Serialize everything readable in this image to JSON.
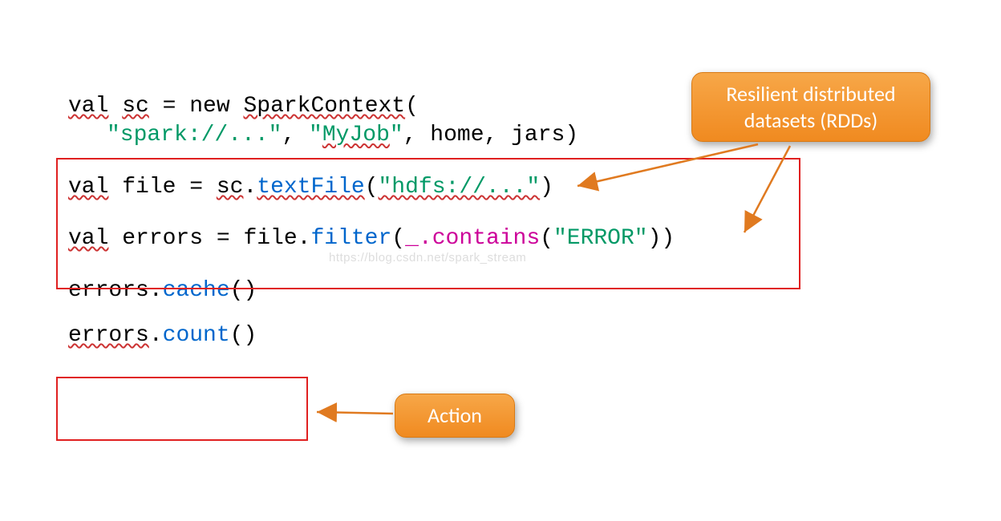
{
  "code": {
    "line1": {
      "val": "val",
      "sc": "sc",
      "eqNew": " = new ",
      "sparkContext": "SparkContext",
      "paren": "("
    },
    "line2": {
      "str1": "\"spark://...\"",
      "comma1": ", ",
      "str2": "\"MyJob\"",
      "rest": ", home, jars)"
    },
    "line3": {
      "val": "val",
      "sp": " file = ",
      "obj": "sc",
      "dot": ".",
      "method": "textFile",
      "paren1": "(",
      "arg": "\"hdfs://...\"",
      "paren2": ")"
    },
    "line4": {
      "val": "val",
      "sp": " errors = file.",
      "method": "filter",
      "paren1": "(",
      "under": "_",
      "dot": ".",
      "contains": "contains",
      "paren2": "(",
      "arg": "\"ERROR\"",
      "paren3": "))"
    },
    "line5": {
      "obj": "errors.",
      "method": "cache",
      "paren": "()"
    },
    "line6": {
      "obj": "errors.",
      "method": "count",
      "paren": "()"
    }
  },
  "callouts": {
    "rdd_line1": "Resilient distributed",
    "rdd_line2": "datasets (RDDs)",
    "action": "Action"
  },
  "watermark": "https://blog.csdn.net/spark_stream",
  "colors": {
    "accent": "#f08a20",
    "box": "#e02020"
  }
}
